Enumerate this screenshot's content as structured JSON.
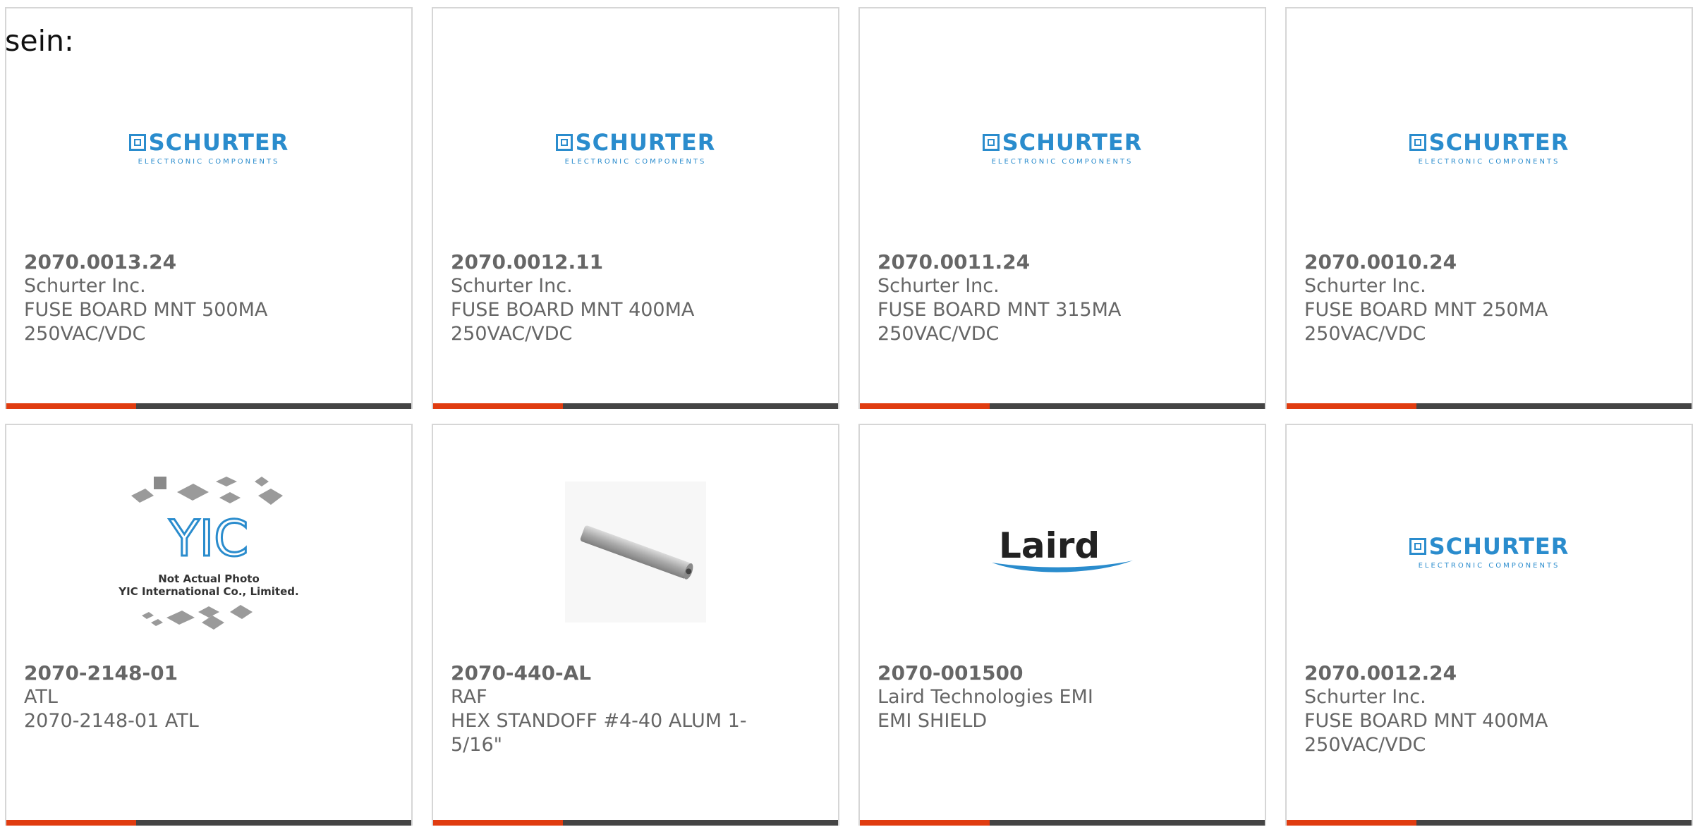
{
  "page": {
    "intro_text": "sein:"
  },
  "products": [
    {
      "part_number": "2070.0013.24",
      "manufacturer": "Schurter Inc.",
      "description": "FUSE BOARD MNT 500MA 250VAC/VDC",
      "image": "schurter-logo"
    },
    {
      "part_number": "2070.0012.11",
      "manufacturer": "Schurter Inc.",
      "description": "FUSE BOARD MNT 400MA 250VAC/VDC",
      "image": "schurter-logo"
    },
    {
      "part_number": "2070.0011.24",
      "manufacturer": "Schurter Inc.",
      "description": "FUSE BOARD MNT 315MA 250VAC/VDC",
      "image": "schurter-logo"
    },
    {
      "part_number": "2070.0010.24",
      "manufacturer": "Schurter Inc.",
      "description": "FUSE BOARD MNT 250MA 250VAC/VDC",
      "image": "schurter-logo"
    },
    {
      "part_number": "2070-2148-01",
      "manufacturer": "ATL",
      "description": "2070-2148-01 ATL",
      "image": "yic-placeholder"
    },
    {
      "part_number": "2070-440-AL",
      "manufacturer": "RAF",
      "description": "HEX STANDOFF #4-40 ALUM 1-5/16\"",
      "image": "standoff-photo"
    },
    {
      "part_number": "2070-001500",
      "manufacturer": "Laird Technologies EMI",
      "description": "EMI SHIELD",
      "image": "laird-logo"
    },
    {
      "part_number": "2070.0012.24",
      "manufacturer": "Schurter Inc.",
      "description": "FUSE BOARD MNT 400MA 250VAC/VDC",
      "image": "schurter-logo"
    }
  ],
  "logos": {
    "schurter": {
      "brand": "SCHURTER",
      "tagline": "ELECTRONIC COMPONENTS"
    },
    "laird": {
      "brand": "Laird"
    },
    "yic": {
      "mark": "YIC",
      "line1": "Not Actual Photo",
      "line2": "YIC International Co., Limited."
    }
  },
  "colors": {
    "accent": "#e03c10",
    "bar": "#444444",
    "brand_blue": "#2a8ccd",
    "text": "#666666"
  }
}
